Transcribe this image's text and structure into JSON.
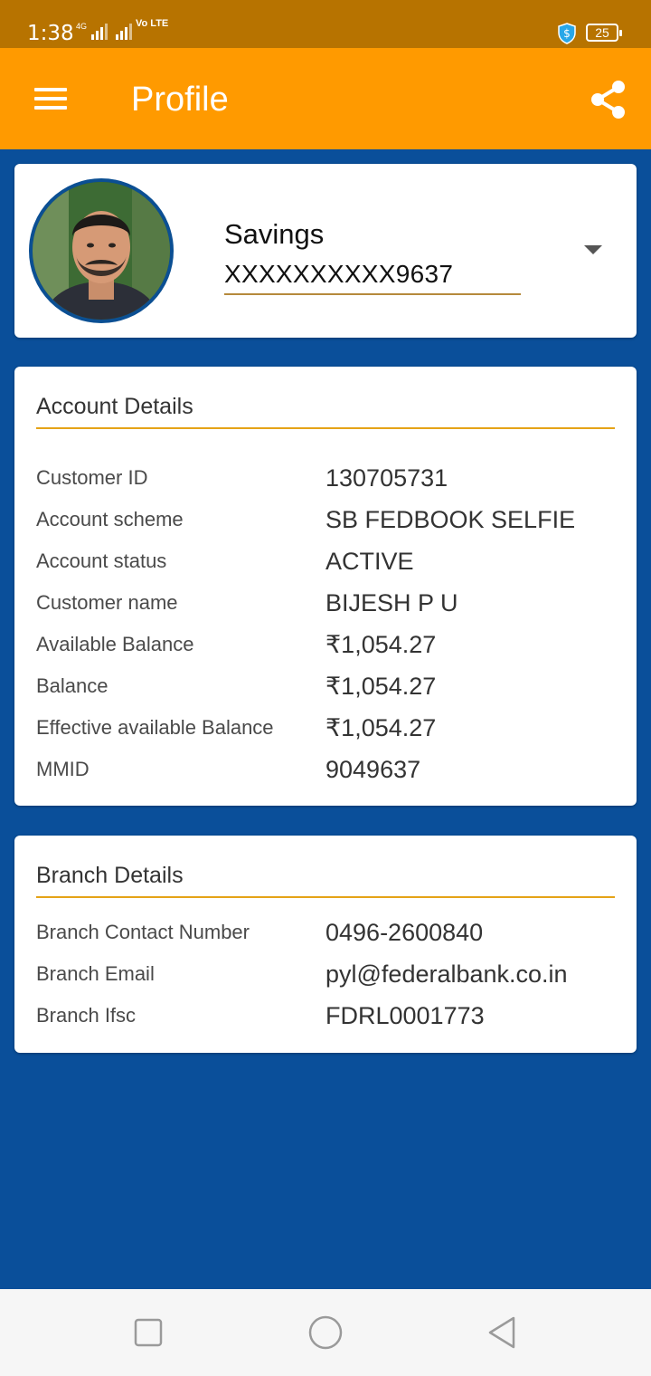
{
  "status_bar": {
    "time": "1:38",
    "network": "4G",
    "volte": "Vo LTE",
    "battery": "25",
    "icons": [
      "signal-icon",
      "volte-icon",
      "shield-icon",
      "battery-icon"
    ]
  },
  "app_bar": {
    "title": "Profile",
    "menu_icon": "hamburger-menu-icon",
    "share_icon": "share-icon",
    "color": "#ff9a00"
  },
  "profile": {
    "account_type": "Savings",
    "account_number": "XXXXXXXXXX9637",
    "dropdown_icon": "dropdown-arrow-icon"
  },
  "account_details": {
    "title": "Account Details",
    "rows": [
      {
        "label": "Customer ID",
        "value": "130705731"
      },
      {
        "label": "Account scheme",
        "value": "SB FEDBOOK SELFIE"
      },
      {
        "label": "Account status",
        "value": "ACTIVE"
      },
      {
        "label": "Customer name",
        "value": "BIJESH P U"
      },
      {
        "label": "Available Balance",
        "value": "₹1,054.27"
      },
      {
        "label": "Balance",
        "value": "₹1,054.27"
      },
      {
        "label": "Effective available Balance",
        "value": "₹1,054.27"
      },
      {
        "label": "MMID",
        "value": "9049637"
      }
    ]
  },
  "branch_details": {
    "title": "Branch Details",
    "rows": [
      {
        "label": "Branch Contact Number",
        "value": "0496-2600840"
      },
      {
        "label": "Branch Email",
        "value": "pyl@federalbank.co.in"
      },
      {
        "label": "Branch Ifsc",
        "value": "FDRL0001773"
      }
    ]
  },
  "colors": {
    "status_bar": "#b77300",
    "background": "#0a4f9a",
    "accent_line": "#e5a317"
  }
}
